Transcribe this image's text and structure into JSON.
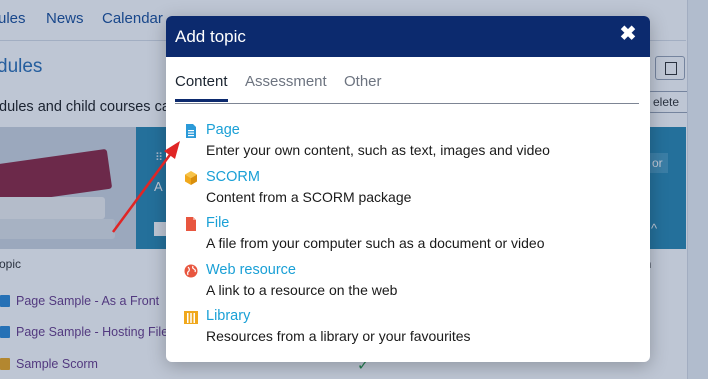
{
  "background": {
    "tabs": [
      "ules",
      "News",
      "Calendar"
    ],
    "section_title": "dules",
    "subtitle": "dules and child courses ca",
    "delete_button": "elete",
    "column_topic": "opic",
    "column_right": "en",
    "rows": [
      "Page Sample - As a Front",
      "Page Sample - Hosting File",
      "Sample Scorm"
    ],
    "hero_fragment": "A",
    "hero_btn_fragment": "or"
  },
  "modal": {
    "title": "Add topic",
    "close_icon": "✖",
    "tabs": [
      {
        "label": "Content",
        "active": true
      },
      {
        "label": "Assessment",
        "active": false
      },
      {
        "label": "Other",
        "active": false
      }
    ],
    "items": [
      {
        "label": "Page",
        "description": "Enter your own content, such as text, images and video",
        "icon": "page-icon",
        "color": "#2b9ad8"
      },
      {
        "label": "SCORM",
        "description": "Content from a SCORM package",
        "icon": "scorm-cube-icon",
        "color": "#f0a81c"
      },
      {
        "label": "File",
        "description": "A file from your computer such as a document or video",
        "icon": "file-icon",
        "color": "#e8563f"
      },
      {
        "label": "Web resource",
        "description": "A link to a resource on the web",
        "icon": "globe-icon",
        "color": "#e8563f"
      },
      {
        "label": "Library",
        "description": "Resources from a library or your favourites",
        "icon": "library-icon",
        "color": "#f0a81c"
      }
    ]
  },
  "colors": {
    "header_bg": "#0c2a6e",
    "link": "#1aa0d6",
    "annotation_arrow": "#e02525"
  }
}
